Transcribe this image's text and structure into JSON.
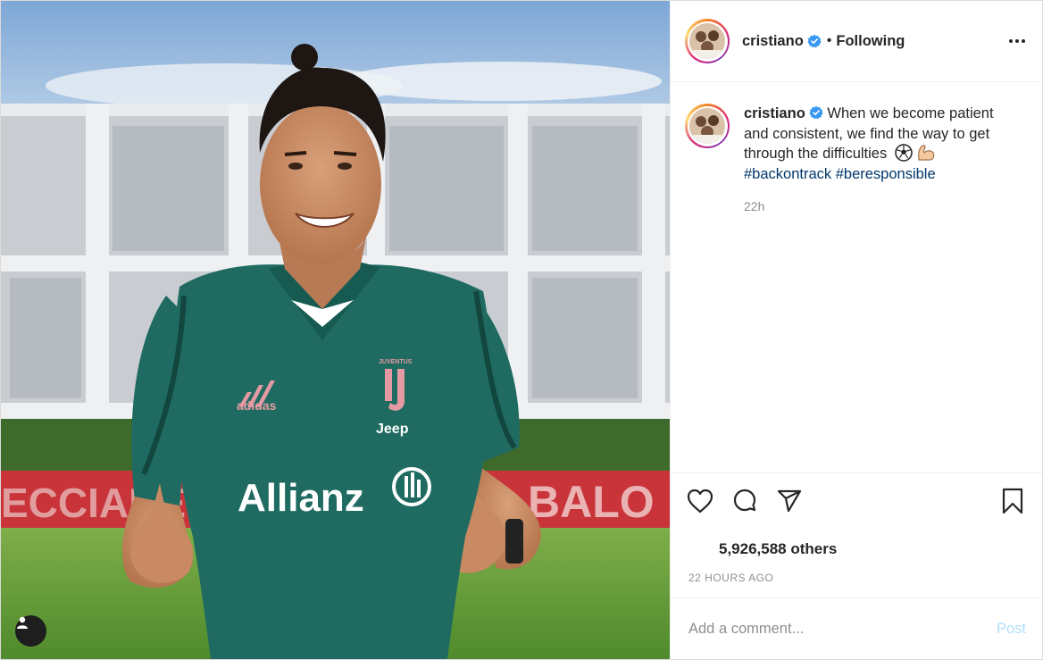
{
  "post": {
    "username": "cristiano",
    "follow_state": "Following",
    "separator": "•",
    "caption": "When we become patient and consistent, we find the way to get through the difficulties",
    "caption_emoji": [
      "soccer-ball",
      "flexed-biceps"
    ],
    "hashtags": [
      "#backontrack",
      "#beresponsible"
    ],
    "time_short": "22h",
    "likes": "5,926,588 others",
    "time_long": "22 HOURS AGO",
    "photo_text": {
      "jersey_sponsor": "Allianz",
      "jersey_logo": "Jeep",
      "brand": "adidas",
      "club": "JUVENTUS"
    }
  },
  "comment_box": {
    "placeholder": "Add a comment...",
    "post_label": "Post"
  },
  "colors": {
    "link": "#00376b",
    "verified": "#3897f0",
    "post_disabled": "#b2dffc",
    "jersey": "#1f6b61"
  },
  "icons": [
    "heart-icon",
    "comment-icon",
    "share-icon",
    "bookmark-icon",
    "more-options-icon",
    "verified-badge-icon",
    "user-tag-icon"
  ]
}
